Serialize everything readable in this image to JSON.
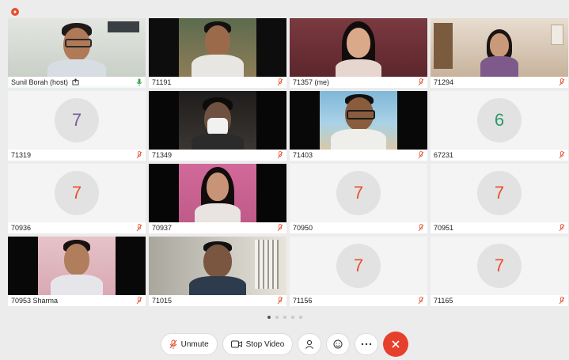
{
  "colors": {
    "accent": "#5fb7d6",
    "mic_on": "#3fa34d",
    "mic_off": "#e8502f",
    "end": "#e6402d",
    "avatar7": "#e8502f",
    "avatar6": "#2e9a6b"
  },
  "participants": [
    {
      "name": "Sunil Borah (host)",
      "share_icon": "share-icon",
      "mic": "on",
      "video": true
    },
    {
      "name": "71191",
      "mic": "off",
      "video": true
    },
    {
      "name": "71357 (me)",
      "mic": "off",
      "video": true
    },
    {
      "name": "71294",
      "mic": "off",
      "video": true
    },
    {
      "name": "71319",
      "mic": "off",
      "video": false,
      "avatar": "7",
      "avatar_color": "#7b5aa0"
    },
    {
      "name": "71349",
      "mic": "off",
      "video": true
    },
    {
      "name": "71403",
      "mic": "off",
      "video": true
    },
    {
      "name": "67231",
      "mic": "off",
      "video": false,
      "avatar": "6",
      "avatar_color": "#2e9a6b"
    },
    {
      "name": "70936",
      "mic": "off",
      "video": false,
      "avatar": "7",
      "avatar_color": "#e8502f"
    },
    {
      "name": "70937",
      "mic": "off",
      "video": true
    },
    {
      "name": "70950",
      "mic": "off",
      "video": false,
      "avatar": "7",
      "avatar_color": "#e8502f"
    },
    {
      "name": "70951",
      "mic": "off",
      "video": false,
      "avatar": "7",
      "avatar_color": "#e8502f"
    },
    {
      "name": "70953 Sharma",
      "mic": "off",
      "video": true
    },
    {
      "name": "71015",
      "mic": "off",
      "video": true
    },
    {
      "name": "71156",
      "mic": "off",
      "video": false,
      "avatar": "7",
      "avatar_color": "#e8502f"
    },
    {
      "name": "71165",
      "mic": "off",
      "video": false,
      "avatar": "7",
      "avatar_color": "#e8502f"
    }
  ],
  "pager": {
    "pages": 5,
    "active": 0
  },
  "toolbar": {
    "unmute_label": "Unmute",
    "stop_video_label": "Stop Video",
    "participants_icon": "participants-icon",
    "reactions_icon": "reactions-icon",
    "more_icon": "more-icon",
    "end_icon": "end-call-icon"
  }
}
